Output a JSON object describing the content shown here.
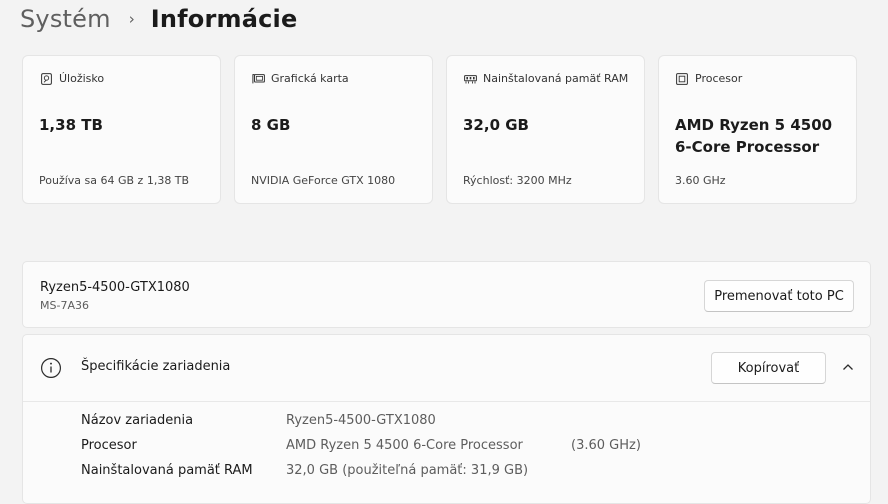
{
  "breadcrumb": {
    "parent": "Systém",
    "separator": "›",
    "current": "Informácie"
  },
  "cards": [
    {
      "icon": "storage-icon",
      "label": "Úložisko",
      "value": "1,38 TB",
      "sub": "Používa sa 64 GB z 1,38 TB"
    },
    {
      "icon": "graphics-card-icon",
      "label": "Grafická karta",
      "value": "8 GB",
      "sub": "NVIDIA GeForce GTX 1080"
    },
    {
      "icon": "ram-icon",
      "label": "Nainštalovaná pamäť RAM",
      "value": "32,0 GB",
      "sub": "Rýchlosť: 3200 MHz"
    },
    {
      "icon": "processor-icon",
      "label": "Procesor",
      "value": "AMD Ryzen 5 4500 6-Core Processor",
      "sub": "3.60 GHz"
    }
  ],
  "device": {
    "name": "Ryzen5-4500-GTX1080",
    "model": "MS-7A36",
    "rename_label": "Premenovať toto PC"
  },
  "specs": {
    "title": "Špecifikácie zariadenia",
    "copy_label": "Kopírovať",
    "rows": [
      {
        "label": "Názov zariadenia",
        "value": "Ryzen5-4500-GTX1080",
        "extra": ""
      },
      {
        "label": "Procesor",
        "value": "AMD Ryzen 5 4500 6-Core Processor",
        "extra": "(3.60 GHz)"
      },
      {
        "label": "Nainštalovaná pamäť RAM",
        "value": "32,0 GB (použiteľná pamäť: 31,9 GB)",
        "extra": ""
      }
    ]
  },
  "colors": {
    "background": "#f3f3f3",
    "card": "#fbfbfb",
    "border": "#e5e5e5",
    "text": "#1b1b1b",
    "secondary_text": "#5d5d5d"
  }
}
